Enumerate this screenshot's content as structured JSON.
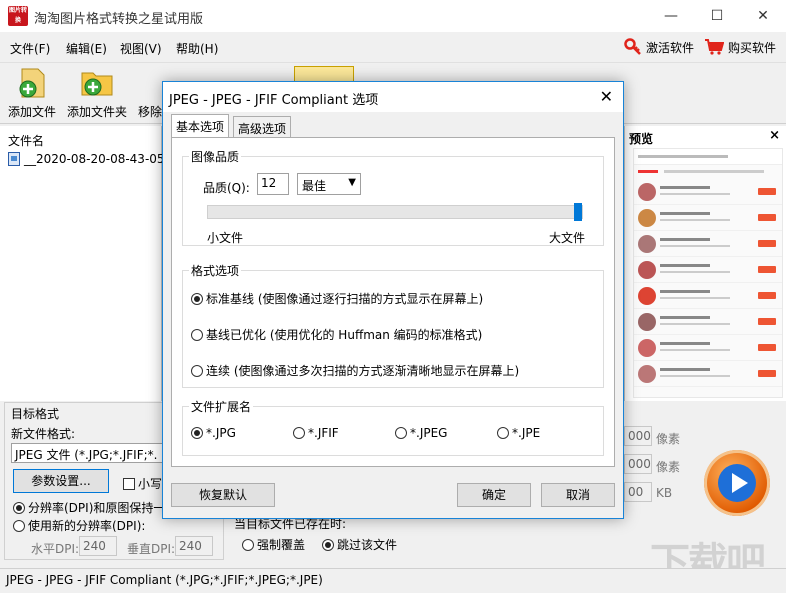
{
  "app": {
    "icon_text": "图片转换",
    "title": "淘淘图片格式转换之星试用版",
    "minimize": "—",
    "maximize": "☐",
    "close": "✕"
  },
  "menu": {
    "file": "文件(F)",
    "edit": "编辑(E)",
    "view": "视图(V)",
    "help": "帮助(H)",
    "activate": "激活软件",
    "buy": "购买软件"
  },
  "toolbar": {
    "add_file": "添加文件",
    "add_folder": "添加文件夹",
    "remove": "移除"
  },
  "filelist": {
    "header": "文件名",
    "rows": [
      "__2020-08-20-08-43-05"
    ]
  },
  "preview": {
    "title": "预览",
    "close": "×"
  },
  "target": {
    "group_title": "目标格式",
    "new_format_label": "新文件格式:",
    "format_value": "JPEG 文件 (*.JPG;*.JFIF;*.",
    "params_button": "参数设置...",
    "lowercase_label": "小写",
    "keep_dpi": "分辨率(DPI)和原图保持一",
    "new_dpi": "使用新的分辨率(DPI):",
    "h_dpi_label": "水平DPI:",
    "h_dpi_value": "240",
    "v_dpi_label": "垂直DPI:",
    "v_dpi_value": "240"
  },
  "exists": {
    "label": "当目标文件已存在时:",
    "overwrite": "强制覆盖",
    "skip": "跳过该文件"
  },
  "size_fields": {
    "w_value": "000",
    "w_unit": "像素",
    "h_value": "000",
    "h_unit": "像素",
    "kb_value": "00",
    "kb_unit": "KB"
  },
  "watermark": "下载吧",
  "status": {
    "text": "JPEG - JPEG - JFIF Compliant (*.JPG;*.JFIF;*.JPEG;*.JPE)"
  },
  "dialog": {
    "title": "JPEG - JPEG - JFIF Compliant 选项",
    "close": "✕",
    "tab_basic": "基本选项",
    "tab_advanced": "高级选项",
    "quality_group": "图像品质",
    "quality_label": "品质(Q):",
    "quality_value": "12",
    "quality_preset": "最佳",
    "quality_level": 1.0,
    "small_file": "小文件",
    "large_file": "大文件",
    "format_group": "格式选项",
    "fmt_baseline": "标准基线 (使图像通过逐行扫描的方式显示在屏幕上)",
    "fmt_optimized": "基线已优化 (使用优化的 Huffman 编码的标准格式)",
    "fmt_progressive": "连续 (使图像通过多次扫描的方式逐渐清晰地显示在屏幕上)",
    "ext_group": "文件扩展名",
    "ext_jpg": "*.JPG",
    "ext_jfif": "*.JFIF",
    "ext_jpeg": "*.JPEG",
    "ext_jpe": "*.JPE",
    "restore": "恢复默认",
    "ok": "确定",
    "cancel": "取消"
  }
}
